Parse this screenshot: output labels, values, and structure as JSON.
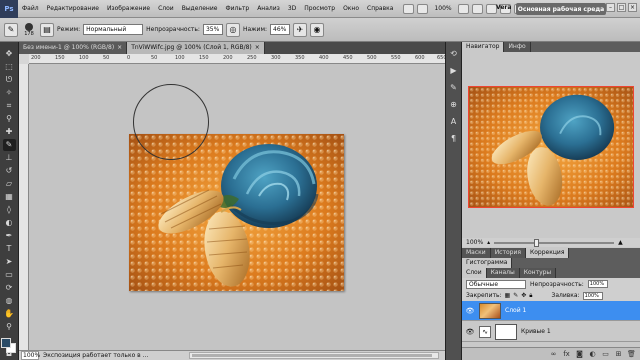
{
  "app": {
    "logo": "Ps"
  },
  "menu": {
    "items": [
      "Файл",
      "Редактирование",
      "Изображение",
      "Слои",
      "Выделение",
      "Фильтр",
      "Анализ",
      "3D",
      "Просмотр",
      "Окно",
      "Справка"
    ],
    "zoom": "100%",
    "user": "Vera",
    "workspace": "Основная рабочая среда"
  },
  "options": {
    "brush_size": "178",
    "mode_label": "Режим:",
    "mode_value": "Нормальный",
    "opacity_label": "Непрозрачность:",
    "opacity_value": "35%",
    "flow_label": "Нажим:",
    "flow_value": "46%"
  },
  "tabs": [
    {
      "label": "Без имени-1 @ 100% (RGB/8)",
      "close": "×"
    },
    {
      "label": "TnViWWifc.jpg @ 100% (Слой 1, RGB/8)",
      "close": "×"
    }
  ],
  "ruler": {
    "h": [
      "200",
      "150",
      "100",
      "50",
      "0",
      "50",
      "100",
      "150",
      "200",
      "250",
      "300",
      "350",
      "400",
      "450",
      "500",
      "550",
      "600",
      "650"
    ]
  },
  "status": {
    "zoom": "100%",
    "text": "Экспозиция работает только в ..."
  },
  "panels": {
    "navigator_tabs": [
      "Навигатор",
      "Инфо"
    ],
    "nav_zoom": "100%",
    "tabs2": [
      "Маски",
      "История",
      "Коррекция"
    ],
    "tabs3": [
      "Гистограмма"
    ],
    "tabs4": [
      "Слои",
      "Каналы",
      "Контуры"
    ],
    "blend_mode": "Обычные",
    "opacity_label": "Непрозрачность:",
    "opacity_value": "100%",
    "lock_label": "Закрепить:",
    "fill_label": "Заливка:",
    "fill_value": "100%",
    "layers": [
      {
        "name": "Слой 1",
        "selected": true
      },
      {
        "name": "Кривые 1",
        "selected": false
      }
    ]
  },
  "colors": {
    "foreground": "#2a4b66",
    "background": "#ffffff",
    "accent": "#3d8ef0"
  }
}
